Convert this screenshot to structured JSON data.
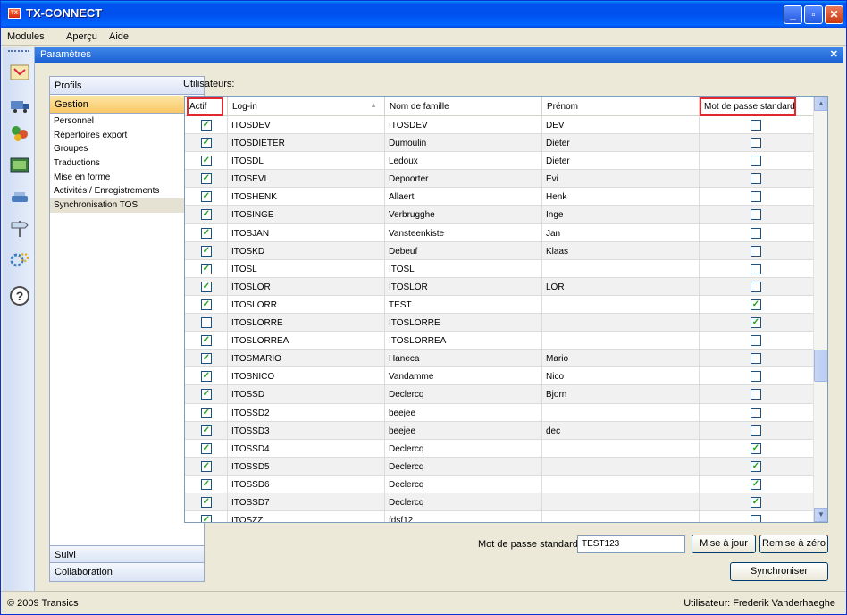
{
  "window": {
    "title": "TX-CONNECT"
  },
  "menu": {
    "items": [
      "Modules",
      "Aperçu",
      "Aide"
    ]
  },
  "panel": {
    "title": "Paramètres"
  },
  "nav": {
    "sections": {
      "profils": "Profils",
      "gestion": "Gestion",
      "suivi": "Suivi",
      "collaboration": "Collaboration"
    },
    "items": [
      "Personnel",
      "Répertoires export",
      "Groupes",
      "Traductions",
      "Mise en forme",
      "Activités / Enregistrements",
      "Synchronisation TOS"
    ],
    "selected_index": 6
  },
  "users": {
    "label": "Utilisateurs:",
    "columns": {
      "actif": "Actif",
      "login": "Log-in",
      "nom": "Nom de famille",
      "prenom": "Prénom",
      "mdp": "Mot de passe standard"
    },
    "rows": [
      {
        "actif": true,
        "login": "ITOSDEV",
        "nom": "ITOSDEV",
        "prenom": "DEV",
        "mdp": false
      },
      {
        "actif": true,
        "login": "ITOSDIETER",
        "nom": "Dumoulin",
        "prenom": "Dieter",
        "mdp": false
      },
      {
        "actif": true,
        "login": "ITOSDL",
        "nom": "Ledoux",
        "prenom": "Dieter",
        "mdp": false
      },
      {
        "actif": true,
        "login": "ITOSEVI",
        "nom": "Depoorter",
        "prenom": "Evi",
        "mdp": false
      },
      {
        "actif": true,
        "login": "ITOSHENK",
        "nom": "Allaert",
        "prenom": "Henk",
        "mdp": false
      },
      {
        "actif": true,
        "login": "ITOSINGE",
        "nom": "Verbrugghe",
        "prenom": "Inge",
        "mdp": false
      },
      {
        "actif": true,
        "login": "ITOSJAN",
        "nom": "Vansteenkiste",
        "prenom": "Jan",
        "mdp": false
      },
      {
        "actif": true,
        "login": "ITOSKD",
        "nom": "Debeuf",
        "prenom": "Klaas",
        "mdp": false
      },
      {
        "actif": true,
        "login": "ITOSL",
        "nom": "ITOSL",
        "prenom": "",
        "mdp": false
      },
      {
        "actif": true,
        "login": "ITOSLOR",
        "nom": "ITOSLOR",
        "prenom": "LOR",
        "mdp": false
      },
      {
        "actif": true,
        "login": "ITOSLORR",
        "nom": "TEST",
        "prenom": "",
        "mdp": true
      },
      {
        "actif": false,
        "login": "ITOSLORRE",
        "nom": "ITOSLORRE",
        "prenom": "",
        "mdp": true
      },
      {
        "actif": true,
        "login": "ITOSLORREA",
        "nom": "ITOSLORREA",
        "prenom": "",
        "mdp": false
      },
      {
        "actif": true,
        "login": "ITOSMARIO",
        "nom": "Haneca",
        "prenom": "Mario",
        "mdp": false
      },
      {
        "actif": true,
        "login": "ITOSNICO",
        "nom": "Vandamme",
        "prenom": "Nico",
        "mdp": false
      },
      {
        "actif": true,
        "login": "ITOSSD",
        "nom": "Declercq",
        "prenom": "Bjorn",
        "mdp": false
      },
      {
        "actif": true,
        "login": "ITOSSD2",
        "nom": "beejee",
        "prenom": "",
        "mdp": false
      },
      {
        "actif": true,
        "login": "ITOSSD3",
        "nom": "beejee",
        "prenom": "dec",
        "mdp": false
      },
      {
        "actif": true,
        "login": "ITOSSD4",
        "nom": "Declercq",
        "prenom": "",
        "mdp": true
      },
      {
        "actif": true,
        "login": "ITOSSD5",
        "nom": "Declercq",
        "prenom": "",
        "mdp": true
      },
      {
        "actif": true,
        "login": "ITOSSD6",
        "nom": "Declercq",
        "prenom": "",
        "mdp": true
      },
      {
        "actif": true,
        "login": "ITOSSD7",
        "nom": "Declercq",
        "prenom": "",
        "mdp": true
      },
      {
        "actif": true,
        "login": "ITOSZZ",
        "nom": "fdsf12",
        "prenom": "",
        "mdp": false
      }
    ]
  },
  "password": {
    "label": "Mot de passe standard:",
    "value": "TEST123"
  },
  "buttons": {
    "update": "Mise à jour",
    "reset": "Remise à zéro",
    "sync": "Synchroniser"
  },
  "status": {
    "copyright": "© 2009 Transics",
    "user": "Utilisateur: Frederik Vanderhaeghe"
  },
  "colors": {
    "title_bar": "#0054e3",
    "nav_active": "#f8c866",
    "highlight": "#e0282e",
    "check": "#21a121"
  },
  "icons": [
    "app-icon",
    "map-icon",
    "truck-icon",
    "people-icon",
    "monitor-icon",
    "tools-icon",
    "signpost-icon",
    "gears-icon",
    "help-icon",
    "sort-arrow-icon",
    "checkbox-icon",
    "scroll-up-icon",
    "scroll-down-icon",
    "minimize-icon",
    "maximize-icon",
    "close-icon"
  ]
}
